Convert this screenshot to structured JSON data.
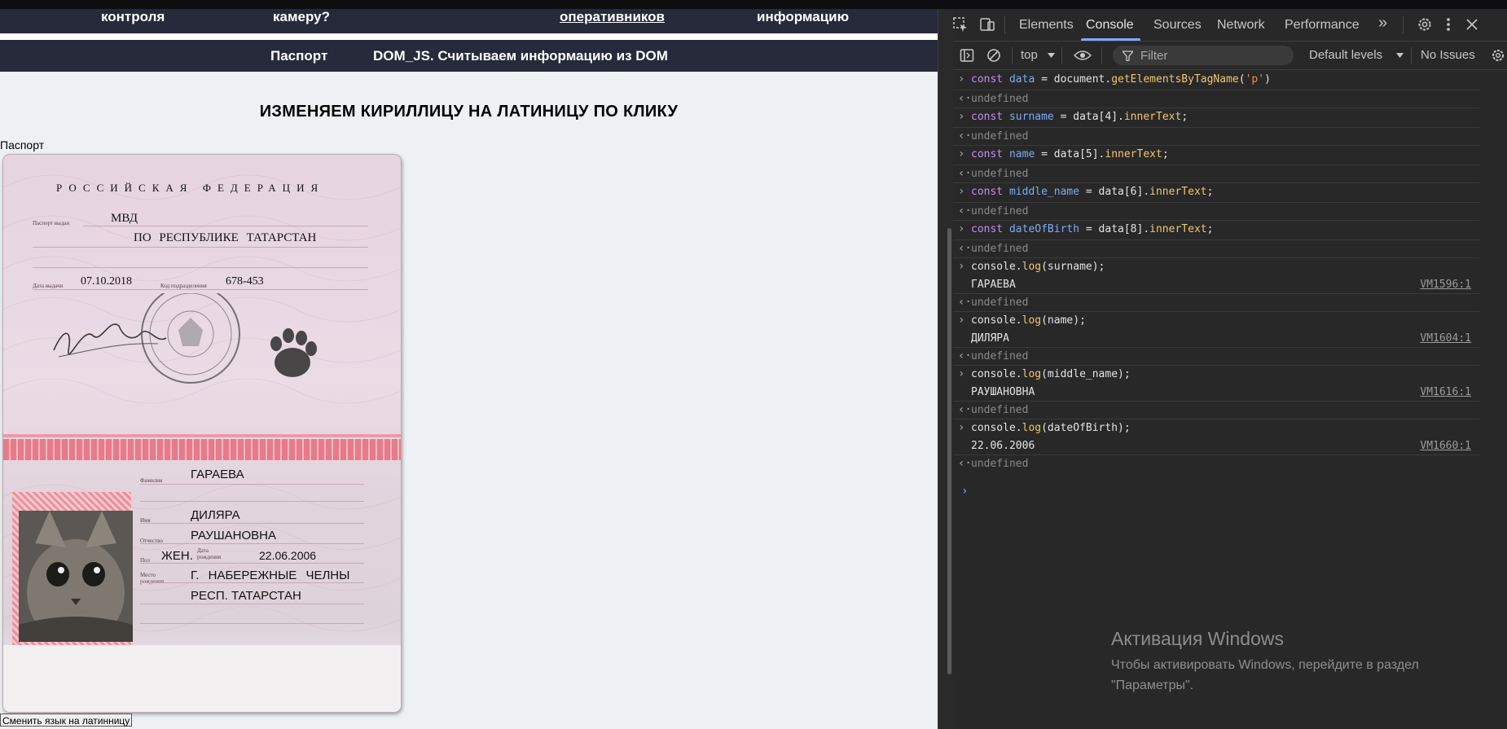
{
  "nav_top": {
    "items": [
      "контроля",
      "камеру?",
      "оперативников",
      "информацию"
    ]
  },
  "nav_main": {
    "items": [
      "Паспорт",
      "DOM_JS. Считываем информацию из DOM"
    ]
  },
  "page": {
    "heading": "ИЗМЕНЯЕМ КИРИЛЛИЦУ НА ЛАТИНИЦУ ПО КЛИКУ",
    "passport_label": "Паспорт",
    "button_label": "Сменить язык на латинницу"
  },
  "passport": {
    "country": "РОССИЙСКАЯ ФЕДЕРАЦИЯ",
    "issued_by_label": "Паспорт выдан",
    "issued_by_line1": "МВД",
    "issued_by_line2": "ПО РЕСПУБЛИКЕ ТАТАРСТАН",
    "issue_date_label": "Дата выдачи",
    "issue_date": "07.10.2018",
    "code_label": "Код подразделения",
    "code": "678-453",
    "surname_label": "Фамилия",
    "surname": "ГАРАЕВА",
    "name_label": "Имя",
    "name": "ДИЛЯРА",
    "patronymic_label": "Отчество",
    "patronymic": "РАУШАНОВНА",
    "sex_label": "Пол",
    "sex": "ЖЕН.",
    "dob_label": "Дата рождения",
    "dob": "22.06.2006",
    "pob_label": "Место рождения",
    "pob_line1": "Г. НАБЕРЕЖНЫЕ ЧЕЛНЫ",
    "pob_line2": "РЕСП. ТАТАРСТАН"
  },
  "devtools": {
    "tabs": [
      "Elements",
      "Console",
      "Sources",
      "Network",
      "Performance"
    ],
    "active_tab": "Console",
    "more_tabs": "»",
    "context": "top",
    "filter_placeholder": "Filter",
    "levels": "Default levels",
    "issues": "No Issues",
    "console": {
      "data_line": {
        "kw": "const",
        "var": "data",
        "mid": " = document.",
        "fn": "getElementsByTagName",
        "open": "(",
        "str": "'p'",
        "close": ")"
      },
      "surname_line": {
        "kw": "const",
        "var": "surname",
        "mid": " = data[4].",
        "fn": "innerText",
        "end": ";"
      },
      "name_line": {
        "kw": "const",
        "var": "name",
        "mid": " = data[5].",
        "fn": "innerText",
        "end": ";"
      },
      "middle_line": {
        "kw": "const",
        "var": "middle_name",
        "mid": " = data[6].",
        "fn": "innerText",
        "end": ";"
      },
      "dob_line": {
        "kw": "const",
        "var": "dateOfBirth",
        "mid": " = data[8].",
        "fn": "innerText",
        "end": ";"
      },
      "undefined": "undefined",
      "log1": {
        "pre": "console.",
        "fn": "log",
        "arg": "(surname);",
        "out": "ГАРАЕВА",
        "src": "VM1596:1"
      },
      "log2": {
        "pre": "console.",
        "fn": "log",
        "arg": "(name);",
        "out": "ДИЛЯРА",
        "src": "VM1604:1"
      },
      "log3": {
        "pre": "console.",
        "fn": "log",
        "arg": "(middle_name);",
        "out": "РАУШАНОВНА",
        "src": "VM1616:1"
      },
      "log4": {
        "pre": "console.",
        "fn": "log",
        "arg": "(dateOfBirth);",
        "out": "22.06.2006",
        "src": "VM1660:1"
      }
    }
  },
  "watermark": {
    "title": "Активация Windows",
    "line1": "Чтобы активировать Windows, перейдите в раздел",
    "line2": "\"Параметры\"."
  },
  "colors": {
    "nav_bg": "#262a3b",
    "devtools_bg": "#282828",
    "tab_active_underline": "#7cacf8"
  }
}
